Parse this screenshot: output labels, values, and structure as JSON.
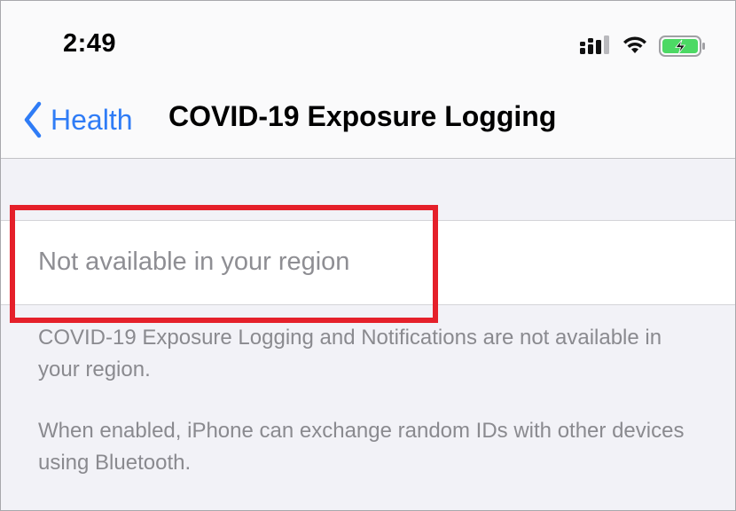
{
  "status_bar": {
    "time": "2:49",
    "icons": [
      "cellular-signal-icon",
      "wifi-icon",
      "battery-charging-icon"
    ],
    "battery_color": "#4cd964"
  },
  "nav": {
    "back_label": "Health",
    "title": "COVID-19 Exposure Logging",
    "accent_color": "#2f7cf6"
  },
  "cell": {
    "label": "Not available in your region"
  },
  "footer": {
    "line1": "COVID-19 Exposure Logging and Notifications are not available in your region.",
    "line2": "When enabled, iPhone can exchange random IDs with other devices using Bluetooth."
  },
  "annotation": {
    "highlight_color": "#e5202a"
  }
}
